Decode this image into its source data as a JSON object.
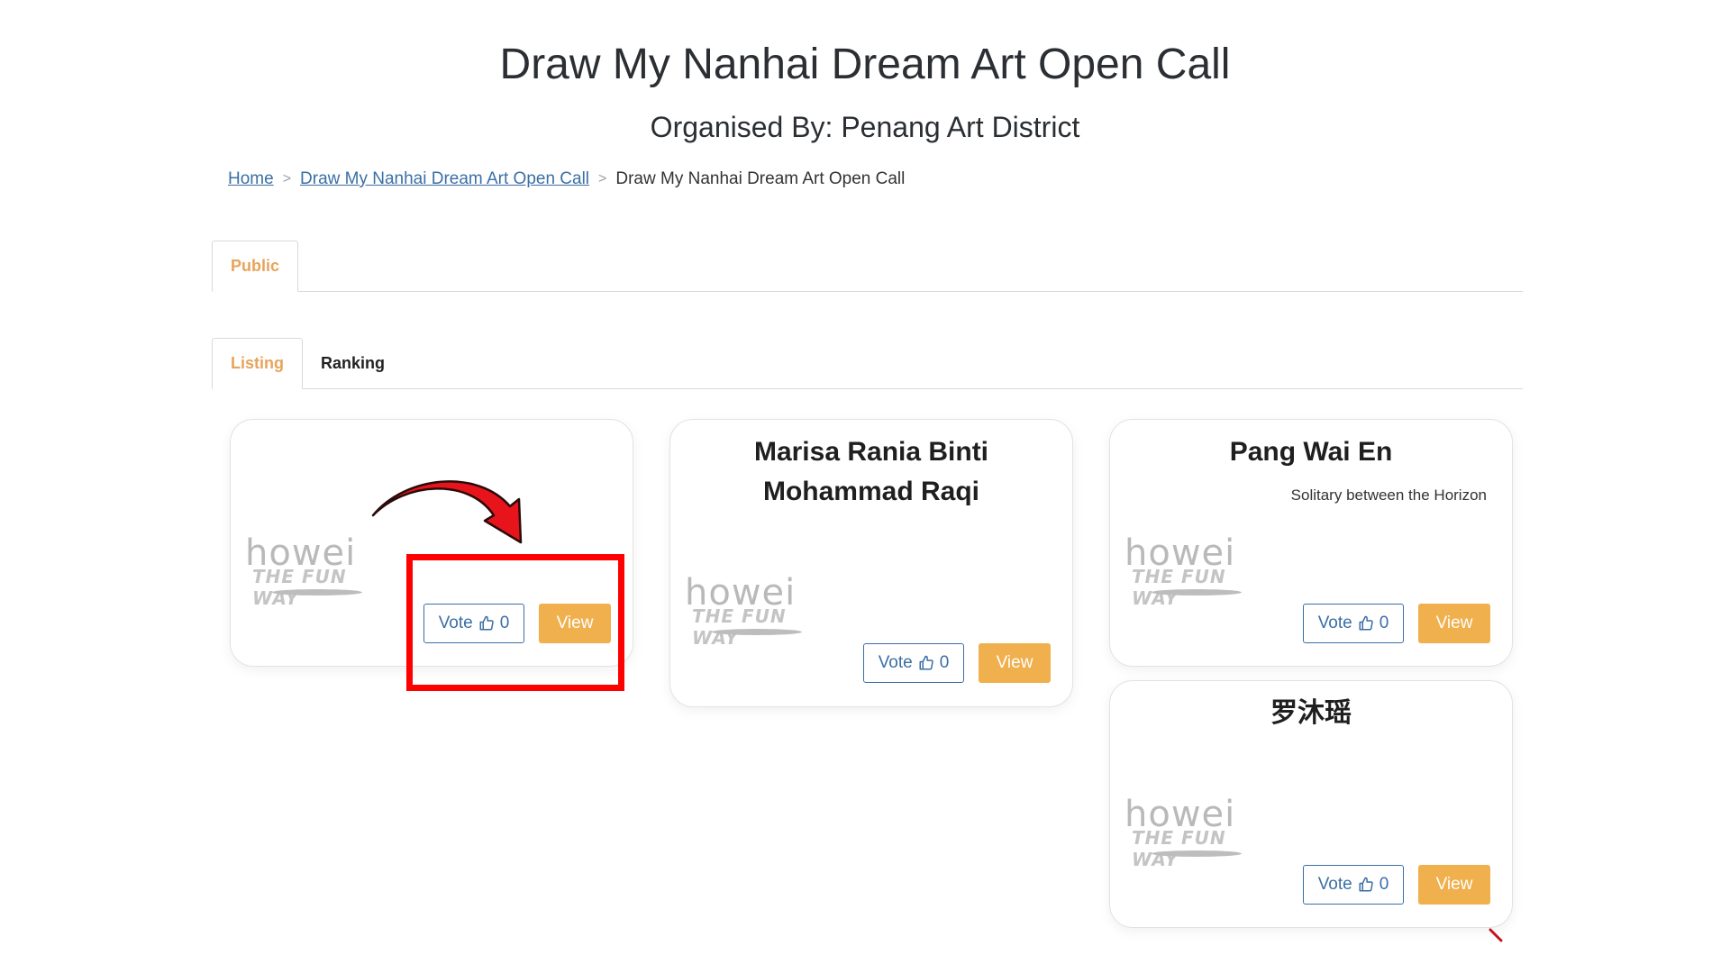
{
  "header": {
    "title": "Draw My Nanhai Dream Art Open Call",
    "subtitle": "Organised By: Penang Art District"
  },
  "breadcrumb": {
    "home": "Home",
    "parent": "Draw My Nanhai Dream Art Open Call",
    "current": "Draw My Nanhai Dream Art Open Call",
    "separator": ">"
  },
  "tabs": {
    "top": [
      {
        "label": "Public",
        "active": true
      }
    ],
    "sub": [
      {
        "label": "Listing",
        "active": true
      },
      {
        "label": "Ranking",
        "active": false
      }
    ]
  },
  "logo": {
    "word": "howei",
    "tag": "THE FUN WAY"
  },
  "cards": [
    {
      "title": "",
      "description": "",
      "vote_label": "Vote",
      "vote_count": "0",
      "view_label": "View"
    },
    {
      "title": "Marisa Rania Binti Mohammad Raqi",
      "description": "",
      "vote_label": "Vote",
      "vote_count": "0",
      "view_label": "View"
    },
    {
      "title": "Pang Wai En",
      "description": "Solitary between the Horizon",
      "vote_label": "Vote",
      "vote_count": "0",
      "view_label": "View"
    },
    {
      "title": "罗沐瑶",
      "description": "",
      "vote_label": "Vote",
      "vote_count": "0",
      "view_label": "View"
    }
  ],
  "colors": {
    "accent_orange": "#efb04d",
    "tab_active": "#e9a35a",
    "link_blue": "#3b6fa5",
    "annotation_red": "#ff0000"
  }
}
